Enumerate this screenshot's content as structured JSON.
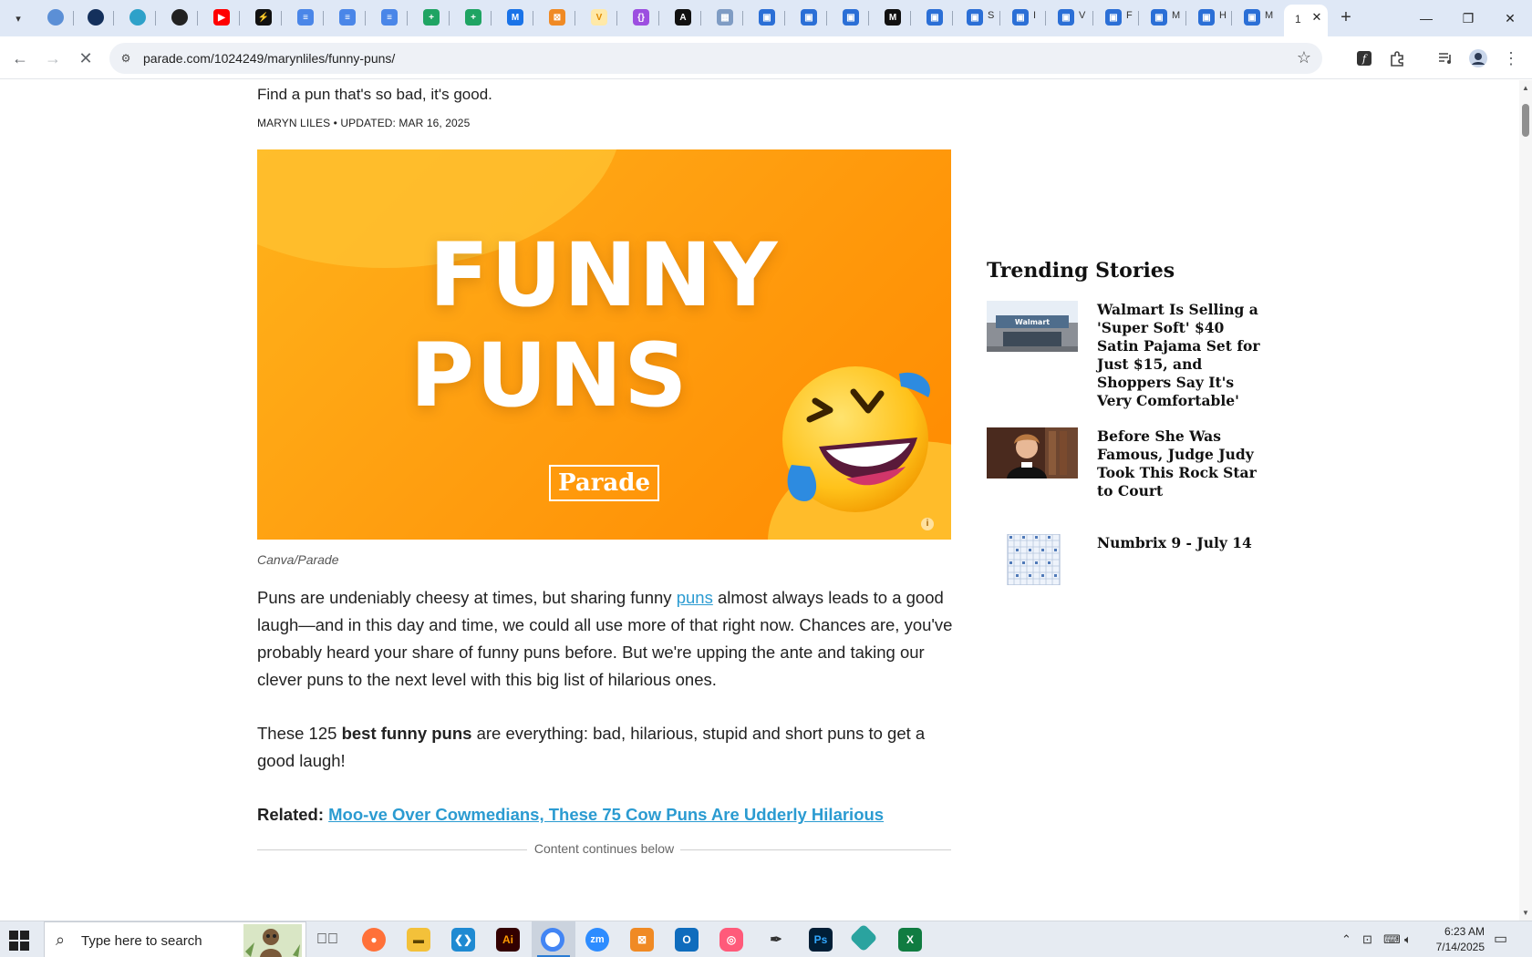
{
  "browser": {
    "active_tab": {
      "title": "1",
      "close_glyph": "✕"
    },
    "new_tab_glyph": "+",
    "window_controls": {
      "minimize": "—",
      "restore": "❐",
      "close": "✕"
    },
    "pinned_tab_labels": {
      "t1": "S",
      "t2": "I",
      "t3": "V",
      "t4": "F",
      "t5": "M",
      "t6": "H",
      "t7": "M"
    },
    "url": "parade.com/1024249/marynliles/funny-puns/"
  },
  "article": {
    "subhead": "Find a pun that's so bad, it's good.",
    "byline": "MARYN LILES • UPDATED: MAR 16, 2025",
    "hero": {
      "line1": "FUNNY",
      "line2": "PUNS",
      "brand": "Parade",
      "info": "i"
    },
    "caption": "Canva/Parade",
    "p1_before": "Puns are undeniably cheesy at times, but sharing funny ",
    "p1_link": "puns",
    "p1_after": " almost always leads to a good laugh—and in this day and time, we could all use more of that right now. Chances are, you've probably heard your share of funny puns before. But we're upping the ante and taking our clever puns to the next level with this big list of hilarious ones.",
    "p2_before": "These 125 ",
    "p2_bold": "best funny puns",
    "p2_after": " are everything: bad, hilarious, stupid and short puns to get a good laugh!",
    "related_label": "Related: ",
    "related_link": "Moo-ve Over Cowmedians, These 75 Cow Puns Are Udderly Hilarious",
    "continues": "Content continues below"
  },
  "trending": {
    "title": "Trending Stories",
    "items": [
      {
        "title": "Walmart Is Selling a 'Super Soft' $40 Satin Pajama Set for Just $15, and Shoppers Say It's Very Comfortable'"
      },
      {
        "title": "Before She Was Famous, Judge Judy Took This Rock Star to Court"
      },
      {
        "title": "Numbrix 9 - July 14"
      }
    ]
  },
  "taskbar": {
    "search_placeholder": "Type here to search",
    "clock_time": "6:23 AM",
    "clock_date": "7/14/2025"
  },
  "colors": {
    "link": "#2b9bd1",
    "hero_orange": "#ff9f10",
    "tabstrip": "#dfe8f6"
  }
}
